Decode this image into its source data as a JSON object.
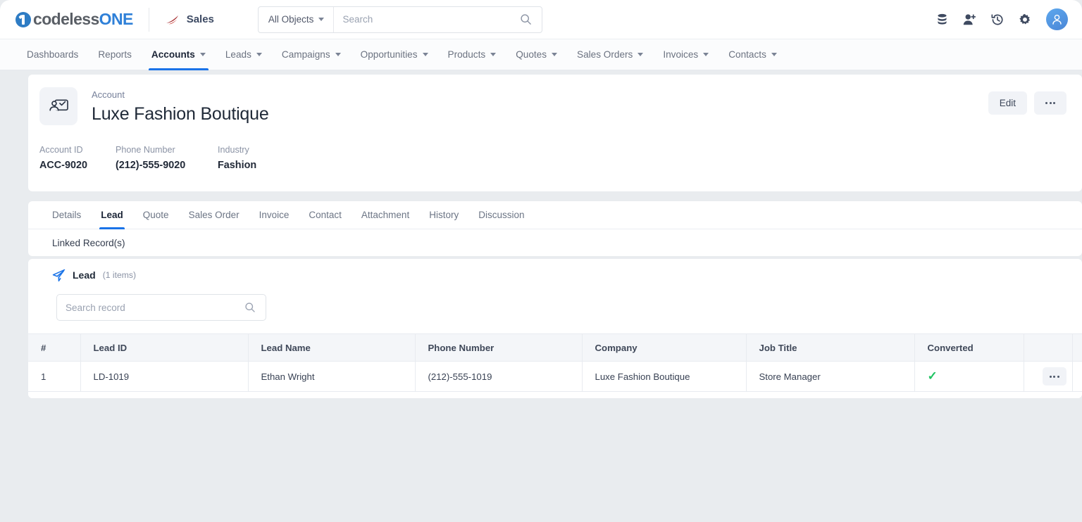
{
  "brand": {
    "logo_text_primary": "codeless",
    "logo_text_accent": "ONE",
    "app_name": "Sales",
    "accent_color": "#1a73e8",
    "logo_blue": "#2f80d8",
    "sales_icon_color": "#a01f22"
  },
  "search": {
    "scope_label": "All Objects",
    "placeholder": "Search",
    "value": ""
  },
  "top_icons": [
    {
      "name": "database-icon"
    },
    {
      "name": "add-user-icon"
    },
    {
      "name": "history-icon"
    },
    {
      "name": "gear-icon"
    },
    {
      "name": "user-avatar"
    }
  ],
  "nav": {
    "items": [
      {
        "label": "Dashboards",
        "has_caret": false,
        "active": false
      },
      {
        "label": "Reports",
        "has_caret": false,
        "active": false
      },
      {
        "label": "Accounts",
        "has_caret": true,
        "active": true
      },
      {
        "label": "Leads",
        "has_caret": true,
        "active": false
      },
      {
        "label": "Campaigns",
        "has_caret": true,
        "active": false
      },
      {
        "label": "Opportunities",
        "has_caret": true,
        "active": false
      },
      {
        "label": "Products",
        "has_caret": true,
        "active": false
      },
      {
        "label": "Quotes",
        "has_caret": true,
        "active": false
      },
      {
        "label": "Sales Orders",
        "has_caret": true,
        "active": false
      },
      {
        "label": "Invoices",
        "has_caret": true,
        "active": false
      },
      {
        "label": "Contacts",
        "has_caret": true,
        "active": false
      }
    ]
  },
  "record": {
    "kind": "Account",
    "name": "Luxe Fashion Boutique",
    "icon": "account-card-icon",
    "edit_label": "Edit",
    "more_label": "",
    "fields": [
      {
        "key": "Account ID",
        "value": "ACC-9020"
      },
      {
        "key": "Phone Number",
        "value": "(212)-555-9020"
      },
      {
        "key": "Industry",
        "value": "Fashion"
      }
    ]
  },
  "detail_tabs": {
    "items": [
      {
        "label": "Details",
        "active": false
      },
      {
        "label": "Lead",
        "active": true
      },
      {
        "label": "Quote",
        "active": false
      },
      {
        "label": "Sales Order",
        "active": false
      },
      {
        "label": "Invoice",
        "active": false
      },
      {
        "label": "Contact",
        "active": false
      },
      {
        "label": "Attachment",
        "active": false
      },
      {
        "label": "History",
        "active": false
      },
      {
        "label": "Discussion",
        "active": false
      }
    ],
    "linked_records_label": "Linked Record(s)"
  },
  "lead_section": {
    "icon": "paper-plane-icon",
    "title": "Lead",
    "count_label": "(1 items)",
    "search_placeholder": "Search record",
    "search_value": "",
    "columns": [
      "#",
      "Lead ID",
      "Lead Name",
      "Phone Number",
      "Company",
      "Job Title",
      "Converted"
    ],
    "rows": [
      {
        "num": "1",
        "lead_id": "LD-1019",
        "lead_name": "Ethan Wright",
        "phone": "(212)-555-1019",
        "company": "Luxe Fashion Boutique",
        "job_title": "Store Manager",
        "converted": "✓"
      }
    ]
  }
}
